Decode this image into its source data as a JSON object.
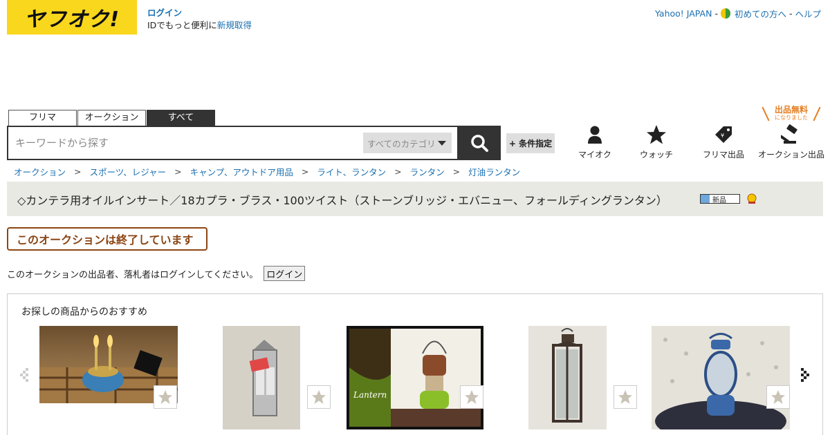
{
  "logo": {
    "text": "ヤフオク!"
  },
  "login": {
    "link": "ログイン",
    "hint_prefix": "IDでもっと便利に",
    "register": "新規取得"
  },
  "topnav": {
    "yahoo": "Yahoo! JAPAN",
    "beginners": "初めての方へ",
    "help": "ヘルプ",
    "sep": "-"
  },
  "tabs": [
    "フリマ",
    "オークション",
    "すべて"
  ],
  "search": {
    "placeholder": "キーワードから探す",
    "category": "すべてのカテゴリ",
    "conditions": "+ 条件指定"
  },
  "shortcuts": {
    "myauc": "マイオク",
    "watch": "ウォッチ",
    "flea_sell": "フリマ出品",
    "auction_sell": "オークション出品"
  },
  "free_badge": {
    "main": "出品無料",
    "sub": "になりました"
  },
  "breadcrumb": [
    "オークション",
    "スポーツ、レジャー",
    "キャンプ、アウトドア用品",
    "ライト、ランタン",
    "ランタン",
    "灯油ランタン"
  ],
  "breadcrumb_sep": ">",
  "item": {
    "title": "◇カンテラ用オイルインサート／18カプラ・ブラス・100ツイスト（ストーンブリッジ・エバニュー、フォールディングランタン）",
    "badge_new": "新品"
  },
  "ended": "このオークションは終了しています",
  "login_note": {
    "text": "このオークションの出品者、落札者はログインしてください。",
    "button": "ログイン"
  },
  "recommend": {
    "heading": "お探しの商品からのおすすめ"
  },
  "colors": {
    "logo_bg": "#f9d71c",
    "link": "#1a6fb0",
    "ended": "#8b4513",
    "free": "#e67e22"
  }
}
